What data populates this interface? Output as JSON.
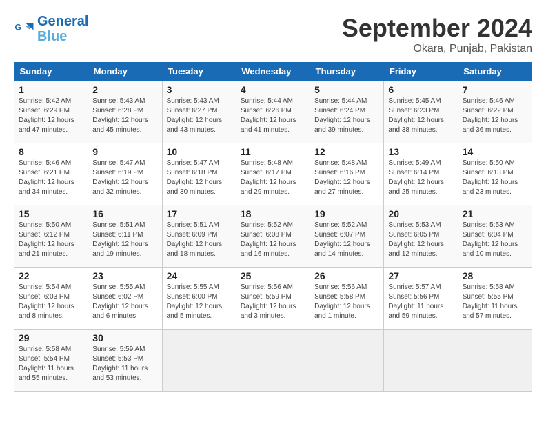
{
  "logo": {
    "line1": "General",
    "line2": "Blue"
  },
  "title": "September 2024",
  "location": "Okara, Punjab, Pakistan",
  "header_days": [
    "Sunday",
    "Monday",
    "Tuesday",
    "Wednesday",
    "Thursday",
    "Friday",
    "Saturday"
  ],
  "weeks": [
    [
      {
        "day": "1",
        "sunrise": "5:42 AM",
        "sunset": "6:29 PM",
        "daylight": "12 hours and 47 minutes."
      },
      {
        "day": "2",
        "sunrise": "5:43 AM",
        "sunset": "6:28 PM",
        "daylight": "12 hours and 45 minutes."
      },
      {
        "day": "3",
        "sunrise": "5:43 AM",
        "sunset": "6:27 PM",
        "daylight": "12 hours and 43 minutes."
      },
      {
        "day": "4",
        "sunrise": "5:44 AM",
        "sunset": "6:26 PM",
        "daylight": "12 hours and 41 minutes."
      },
      {
        "day": "5",
        "sunrise": "5:44 AM",
        "sunset": "6:24 PM",
        "daylight": "12 hours and 39 minutes."
      },
      {
        "day": "6",
        "sunrise": "5:45 AM",
        "sunset": "6:23 PM",
        "daylight": "12 hours and 38 minutes."
      },
      {
        "day": "7",
        "sunrise": "5:46 AM",
        "sunset": "6:22 PM",
        "daylight": "12 hours and 36 minutes."
      }
    ],
    [
      {
        "day": "8",
        "sunrise": "5:46 AM",
        "sunset": "6:21 PM",
        "daylight": "12 hours and 34 minutes."
      },
      {
        "day": "9",
        "sunrise": "5:47 AM",
        "sunset": "6:19 PM",
        "daylight": "12 hours and 32 minutes."
      },
      {
        "day": "10",
        "sunrise": "5:47 AM",
        "sunset": "6:18 PM",
        "daylight": "12 hours and 30 minutes."
      },
      {
        "day": "11",
        "sunrise": "5:48 AM",
        "sunset": "6:17 PM",
        "daylight": "12 hours and 29 minutes."
      },
      {
        "day": "12",
        "sunrise": "5:48 AM",
        "sunset": "6:16 PM",
        "daylight": "12 hours and 27 minutes."
      },
      {
        "day": "13",
        "sunrise": "5:49 AM",
        "sunset": "6:14 PM",
        "daylight": "12 hours and 25 minutes."
      },
      {
        "day": "14",
        "sunrise": "5:50 AM",
        "sunset": "6:13 PM",
        "daylight": "12 hours and 23 minutes."
      }
    ],
    [
      {
        "day": "15",
        "sunrise": "5:50 AM",
        "sunset": "6:12 PM",
        "daylight": "12 hours and 21 minutes."
      },
      {
        "day": "16",
        "sunrise": "5:51 AM",
        "sunset": "6:11 PM",
        "daylight": "12 hours and 19 minutes."
      },
      {
        "day": "17",
        "sunrise": "5:51 AM",
        "sunset": "6:09 PM",
        "daylight": "12 hours and 18 minutes."
      },
      {
        "day": "18",
        "sunrise": "5:52 AM",
        "sunset": "6:08 PM",
        "daylight": "12 hours and 16 minutes."
      },
      {
        "day": "19",
        "sunrise": "5:52 AM",
        "sunset": "6:07 PM",
        "daylight": "12 hours and 14 minutes."
      },
      {
        "day": "20",
        "sunrise": "5:53 AM",
        "sunset": "6:05 PM",
        "daylight": "12 hours and 12 minutes."
      },
      {
        "day": "21",
        "sunrise": "5:53 AM",
        "sunset": "6:04 PM",
        "daylight": "12 hours and 10 minutes."
      }
    ],
    [
      {
        "day": "22",
        "sunrise": "5:54 AM",
        "sunset": "6:03 PM",
        "daylight": "12 hours and 8 minutes."
      },
      {
        "day": "23",
        "sunrise": "5:55 AM",
        "sunset": "6:02 PM",
        "daylight": "12 hours and 6 minutes."
      },
      {
        "day": "24",
        "sunrise": "5:55 AM",
        "sunset": "6:00 PM",
        "daylight": "12 hours and 5 minutes."
      },
      {
        "day": "25",
        "sunrise": "5:56 AM",
        "sunset": "5:59 PM",
        "daylight": "12 hours and 3 minutes."
      },
      {
        "day": "26",
        "sunrise": "5:56 AM",
        "sunset": "5:58 PM",
        "daylight": "12 hours and 1 minute."
      },
      {
        "day": "27",
        "sunrise": "5:57 AM",
        "sunset": "5:56 PM",
        "daylight": "11 hours and 59 minutes."
      },
      {
        "day": "28",
        "sunrise": "5:58 AM",
        "sunset": "5:55 PM",
        "daylight": "11 hours and 57 minutes."
      }
    ],
    [
      {
        "day": "29",
        "sunrise": "5:58 AM",
        "sunset": "5:54 PM",
        "daylight": "11 hours and 55 minutes."
      },
      {
        "day": "30",
        "sunrise": "5:59 AM",
        "sunset": "5:53 PM",
        "daylight": "11 hours and 53 minutes."
      },
      null,
      null,
      null,
      null,
      null
    ]
  ]
}
